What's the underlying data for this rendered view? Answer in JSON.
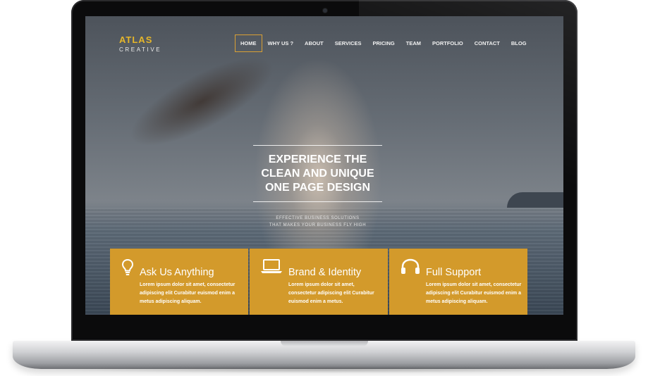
{
  "logo": {
    "title": "ATLAS",
    "subtitle": "CREATIVE"
  },
  "nav": [
    {
      "label": "HOME",
      "active": true
    },
    {
      "label": "WHY US ?",
      "active": false
    },
    {
      "label": "ABOUT",
      "active": false
    },
    {
      "label": "SERVICES",
      "active": false
    },
    {
      "label": "PRICING",
      "active": false
    },
    {
      "label": "TEAM",
      "active": false
    },
    {
      "label": "PORTFOLIO",
      "active": false
    },
    {
      "label": "CONTACT",
      "active": false
    },
    {
      "label": "BLOG",
      "active": false
    }
  ],
  "hero": {
    "title_lines": [
      "EXPERIENCE THE",
      "CLEAN AND UNIQUE",
      "ONE PAGE DESIGN"
    ],
    "subtitle_lines": [
      "EFFECTIVE BUSINESS SOLUTIONS",
      "THAT MAKES YOUR BUSINESS FLY HIGH"
    ]
  },
  "features": [
    {
      "icon": "lightbulb-icon",
      "title": "Ask Us Anything",
      "body": [
        "Lorem ipsum dolor sit amet, consectetur",
        "adipiscing elit Curabitur euismod enim a",
        "metus adipiscing aliquam."
      ]
    },
    {
      "icon": "laptop-icon",
      "title": "Brand & Identity",
      "body": [
        "Lorem ipsum dolor sit amet,",
        "consectetur adipiscing elit Curabitur",
        "euismod enim a metus."
      ]
    },
    {
      "icon": "headphones-icon",
      "title": "Full Support",
      "body": [
        "Lorem ipsum dolor sit amet, consectetur",
        "adipiscing elit Curabitur euismod enim a",
        "metus adipiscing aliquam."
      ]
    }
  ],
  "colors": {
    "accent": "#d39a2b",
    "logo": "#e5b62a"
  }
}
